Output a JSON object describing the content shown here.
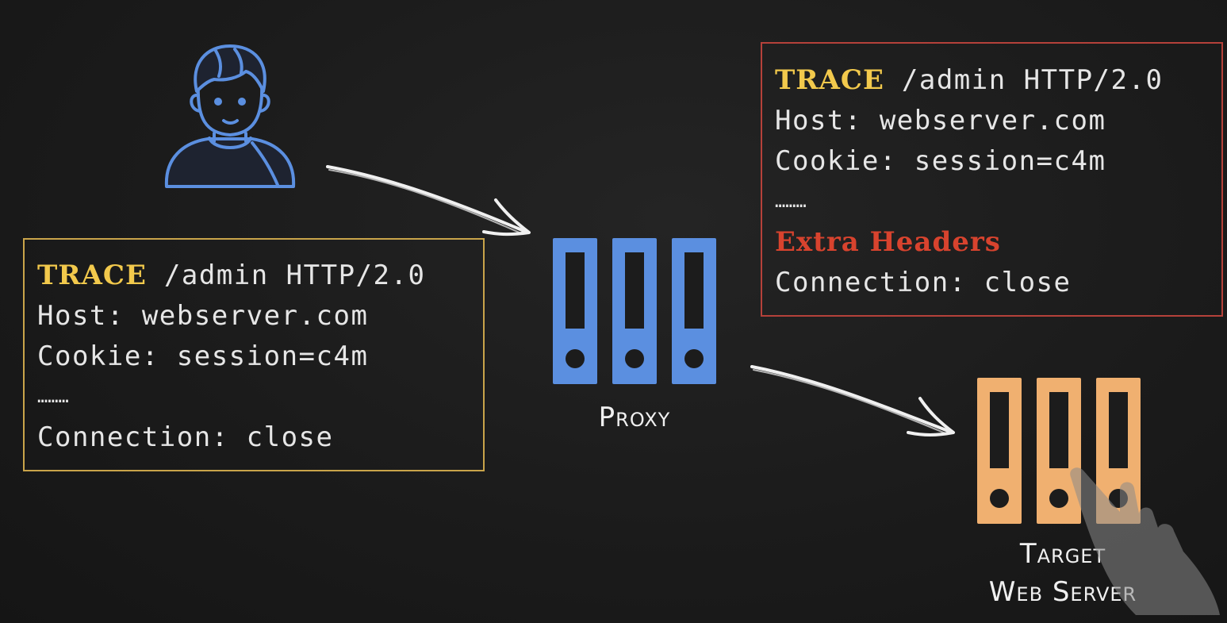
{
  "client_request": {
    "method": "TRACE",
    "request_line_rest": " /admin HTTP/2.0",
    "host_line": "Host: webserver.com",
    "cookie_line": "Cookie: session=c4m",
    "ellipsis": "………",
    "connection_line": "Connection: close"
  },
  "forwarded_request": {
    "method": "TRACE",
    "request_line_rest": " /admin HTTP/2.0",
    "host_line": "Host: webserver.com",
    "cookie_line": "Cookie: session=c4m",
    "ellipsis": "………",
    "extra_headers": "Extra Headers",
    "connection_line": "Connection: close"
  },
  "nodes": {
    "client_icon": "user-avatar-icon",
    "proxy_label": "Proxy",
    "target_label_line1": "Target",
    "target_label_line2": "Web Server"
  },
  "colors": {
    "background": "#1c1c1c",
    "client_box_border": "#c9a44a",
    "forwarded_box_border": "#b5413a",
    "method_highlight": "#f2c94c",
    "extra_headers_highlight": "#d8432e",
    "proxy_server": "#5b8fe0",
    "target_server": "#f0b070",
    "user_icon": "#5b8fe0",
    "arrow": "#f0f0f0"
  }
}
